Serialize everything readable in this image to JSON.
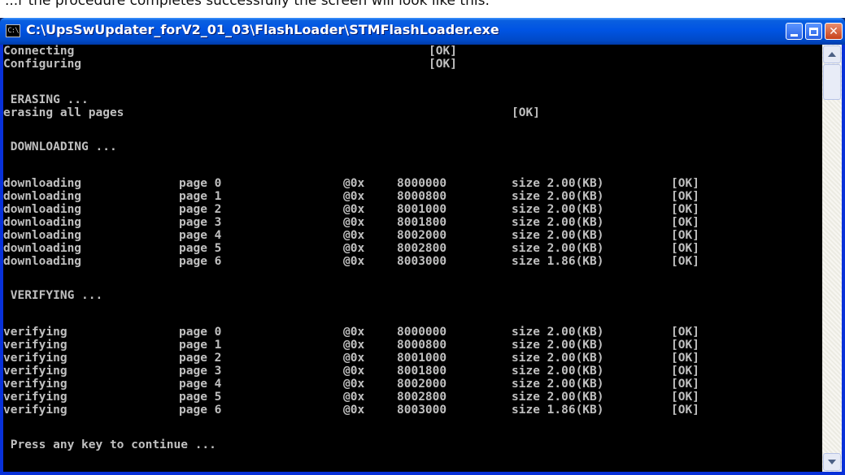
{
  "caption": "...r the procedure completes successfully the screen will look like this:",
  "window": {
    "title": "C:\\UpsSwUpdater_forV2_01_03\\FlashLoader\\STMFlashLoader.exe",
    "icon_text": "C:\\"
  },
  "console": {
    "connecting": "Connecting",
    "configuring": "Configuring",
    "ok": "[OK]",
    "erasing_header": " ERASING ...",
    "erasing_all": "erasing all pages",
    "downloading_header": " DOWNLOADING ...",
    "verifying_header": " VERIFYING ...",
    "press_any_key": " Press any key to continue ...",
    "download_rows": [
      {
        "action": "downloading",
        "page": "page 0",
        "at": "@0x",
        "address": "8000000",
        "size": "size 2.00(KB)",
        "status": "[OK]"
      },
      {
        "action": "downloading",
        "page": "page 1",
        "at": "@0x",
        "address": "8000800",
        "size": "size 2.00(KB)",
        "status": "[OK]"
      },
      {
        "action": "downloading",
        "page": "page 2",
        "at": "@0x",
        "address": "8001000",
        "size": "size 2.00(KB)",
        "status": "[OK]"
      },
      {
        "action": "downloading",
        "page": "page 3",
        "at": "@0x",
        "address": "8001800",
        "size": "size 2.00(KB)",
        "status": "[OK]"
      },
      {
        "action": "downloading",
        "page": "page 4",
        "at": "@0x",
        "address": "8002000",
        "size": "size 2.00(KB)",
        "status": "[OK]"
      },
      {
        "action": "downloading",
        "page": "page 5",
        "at": "@0x",
        "address": "8002800",
        "size": "size 2.00(KB)",
        "status": "[OK]"
      },
      {
        "action": "downloading",
        "page": "page 6",
        "at": "@0x",
        "address": "8003000",
        "size": "size 1.86(KB)",
        "status": "[OK]"
      }
    ],
    "verify_rows": [
      {
        "action": "verifying",
        "page": "page 0",
        "at": "@0x",
        "address": "8000000",
        "size": "size 2.00(KB)",
        "status": "[OK]"
      },
      {
        "action": "verifying",
        "page": "page 1",
        "at": "@0x",
        "address": "8000800",
        "size": "size 2.00(KB)",
        "status": "[OK]"
      },
      {
        "action": "verifying",
        "page": "page 2",
        "at": "@0x",
        "address": "8001000",
        "size": "size 2.00(KB)",
        "status": "[OK]"
      },
      {
        "action": "verifying",
        "page": "page 3",
        "at": "@0x",
        "address": "8001800",
        "size": "size 2.00(KB)",
        "status": "[OK]"
      },
      {
        "action": "verifying",
        "page": "page 4",
        "at": "@0x",
        "address": "8002000",
        "size": "size 2.00(KB)",
        "status": "[OK]"
      },
      {
        "action": "verifying",
        "page": "page 5",
        "at": "@0x",
        "address": "8002800",
        "size": "size 2.00(KB)",
        "status": "[OK]"
      },
      {
        "action": "verifying",
        "page": "page 6",
        "at": "@0x",
        "address": "8003000",
        "size": "size 1.86(KB)",
        "status": "[OK]"
      }
    ]
  },
  "colors": {
    "console_bg": "#000000",
    "console_text": "#c0c0c0",
    "titlebar": "#0054e3"
  },
  "icons": [
    "console-app-icon",
    "minimize-icon",
    "maximize-icon",
    "close-icon",
    "scroll-up-arrow-icon",
    "scroll-down-arrow-icon"
  ]
}
